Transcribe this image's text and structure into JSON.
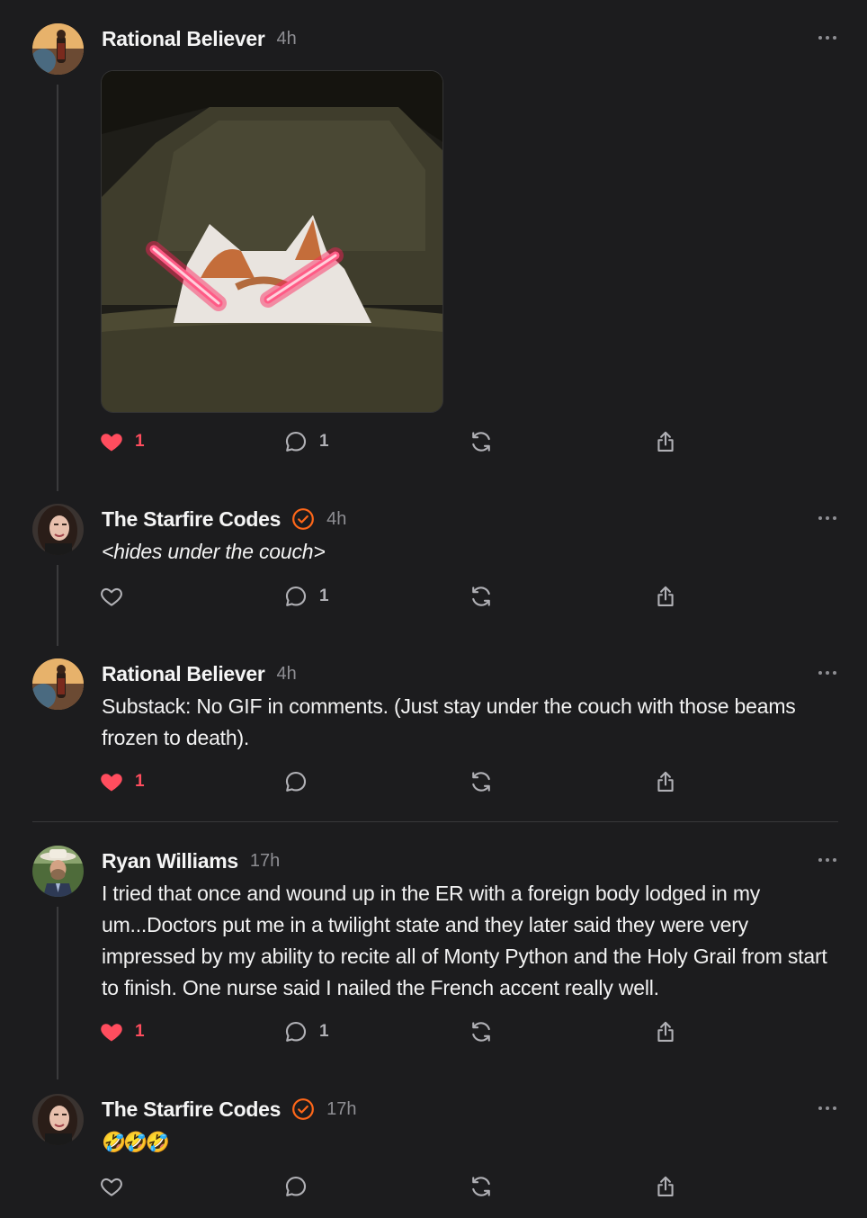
{
  "colors": {
    "background": "#1c1c1e",
    "like_active": "#ff4d5e",
    "verified_badge": "#ff6719",
    "muted": "#8e8e93"
  },
  "posts": [
    {
      "author": "Rational Believer",
      "time": "4h",
      "verified": false,
      "avatar": "rational-believer-avatar",
      "media": "cat-laser-eyes-gif",
      "text": "",
      "likes": "1",
      "liked": true,
      "comments": "1"
    },
    {
      "author": "The Starfire Codes",
      "time": "4h",
      "verified": true,
      "avatar": "starfire-codes-avatar",
      "text": "<hides under the couch>",
      "likes": "",
      "liked": false,
      "comments": "1"
    },
    {
      "author": "Rational Believer",
      "time": "4h",
      "verified": false,
      "avatar": "rational-believer-avatar",
      "text": "Substack: No GIF in comments. (Just stay under the couch with those beams frozen to death).",
      "likes": "1",
      "liked": true,
      "comments": ""
    },
    {
      "author": "Ryan Williams",
      "time": "17h",
      "verified": false,
      "avatar": "ryan-williams-avatar",
      "text": "I tried that once and wound up in the ER with a foreign body lodged in my um...Doctors put me in a twilight state and they later said they were very impressed by my ability to recite all of Monty Python and the Holy Grail from start to finish. One nurse said I nailed the French accent really well.",
      "likes": "1",
      "liked": true,
      "comments": "1"
    },
    {
      "author": "The Starfire Codes",
      "time": "17h",
      "verified": true,
      "avatar": "starfire-codes-avatar",
      "text": "🤣🤣🤣",
      "likes": "",
      "liked": false,
      "comments": ""
    }
  ]
}
